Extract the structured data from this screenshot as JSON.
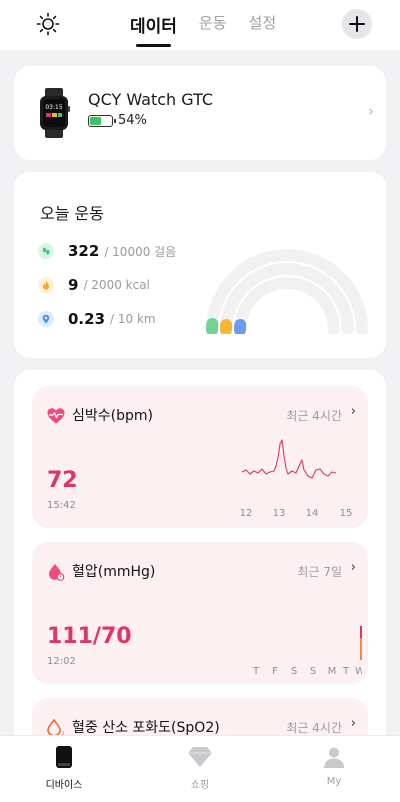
{
  "header": {
    "tabs": [
      {
        "label": "데이터",
        "active": true
      },
      {
        "label": "운동",
        "active": false
      },
      {
        "label": "설정",
        "active": false
      }
    ],
    "left_icon": "sun-icon",
    "right_icon": "plus-icon"
  },
  "device": {
    "name": "QCY Watch GTC",
    "battery_pct": "54%",
    "battery_level": 0.54,
    "watch_face_time": "03:15"
  },
  "today_exercise": {
    "title": "오늘 운동",
    "steps": {
      "value": "322",
      "goal": "/ 10000 걸음",
      "icon": "footsteps-icon",
      "color": "#3dc67d"
    },
    "calories": {
      "value": "9",
      "goal": "/ 2000 kcal",
      "icon": "flame-icon",
      "color": "#f5a623"
    },
    "distance": {
      "value": "0.23",
      "goal": "/ 10 km",
      "icon": "location-pin-icon",
      "color": "#4a8ff0"
    },
    "ring_colors": [
      "#6fd39a",
      "#f7b733",
      "#6c9cf2"
    ]
  },
  "heart_rate": {
    "title": "심박수(bpm)",
    "range": "최근 4시간",
    "value": "72",
    "time": "15:42",
    "x_ticks": [
      "12",
      "13",
      "14",
      "15"
    ],
    "color": "#e0336a"
  },
  "blood_pressure": {
    "title": "혈압(mmHg)",
    "range": "최근 7일",
    "value": "111/70",
    "time": "12:02",
    "x_ticks": [
      "T",
      "F",
      "S",
      "S",
      "M",
      "T",
      "W"
    ],
    "color": "#e0336a"
  },
  "spo2": {
    "title": "혈중 산소 포화도(SpO2)",
    "range": "최근 4시간"
  },
  "bottom_nav": [
    {
      "label": "디바이스",
      "icon": "watch-icon",
      "active": true
    },
    {
      "label": "쇼핑",
      "icon": "diamond-icon",
      "active": false
    },
    {
      "label": "My",
      "icon": "person-icon",
      "active": false
    }
  ]
}
